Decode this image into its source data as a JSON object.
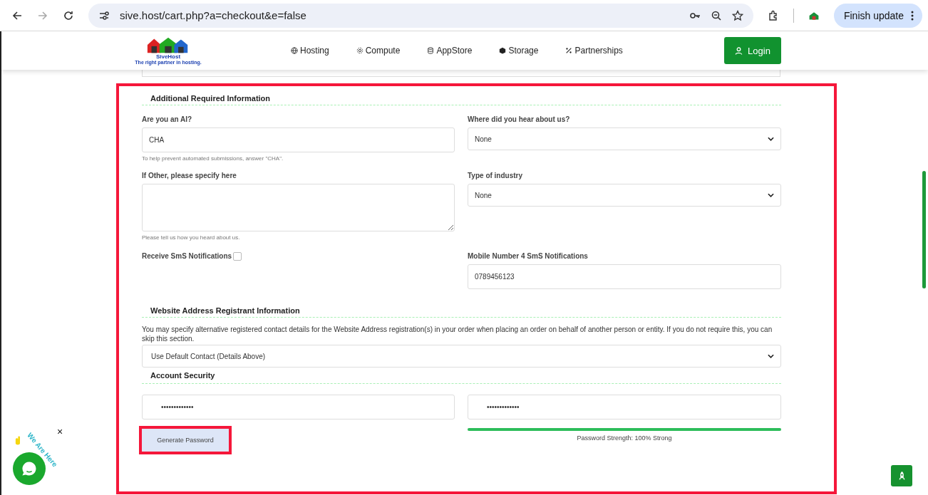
{
  "browser": {
    "url": "sive.host/cart.php?a=checkout&e=false",
    "update_button": "Finish update"
  },
  "header": {
    "logo_name": "SiveHost",
    "logo_tagline": "The right partner in hosting.",
    "nav": [
      {
        "label": "Hosting",
        "kind": "globe"
      },
      {
        "label": "Compute",
        "kind": "gear"
      },
      {
        "label": "AppStore",
        "kind": "database"
      },
      {
        "label": "Storage",
        "kind": "cube"
      },
      {
        "label": "Partnerships",
        "kind": "percent"
      }
    ],
    "login": "Login"
  },
  "additional": {
    "title": "Additional Required Information",
    "ai_label": "Are you an AI?",
    "ai_value": "CHA",
    "ai_help": "To help prevent automated submissions, answer \"CHA\".",
    "hear_label": "Where did you hear about us?",
    "hear_value": "None",
    "other_label": "If Other, please specify here",
    "other_help": "Please tell us how you heard about us.",
    "industry_label": "Type of industry",
    "industry_value": "None",
    "sms_label": "Receive SmS Notifications",
    "sms_checked": false,
    "mobile_label": "Mobile Number 4 SmS Notifications",
    "mobile_value": "0789456123"
  },
  "registrant": {
    "title": "Website Address Registrant Information",
    "text": "You may specify alternative registered contact details for the Website Address registration(s) in your order when placing an order on behalf of another person or entity. If you do not require this, you can skip this section.",
    "contact_value": "Use Default Contact (Details Above)"
  },
  "security": {
    "title": "Account Security",
    "password": "•••••••••••••",
    "confirm": "•••••••••••••",
    "generate": "Generate Password",
    "strength": {
      "level": 1
    },
    "strength_text": "Password Strength: 100% Strong"
  },
  "chat_widget": {
    "label": "We Are Here",
    "close": "×"
  }
}
